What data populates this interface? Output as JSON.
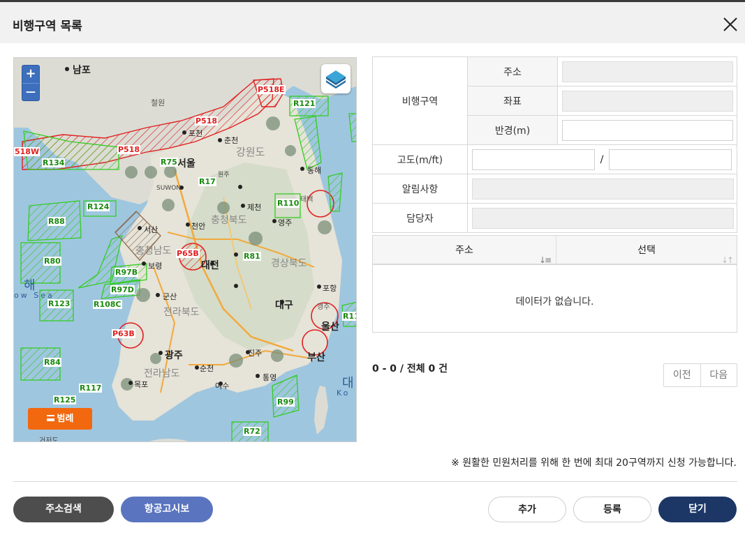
{
  "dialog": {
    "title": "비행구역 목록"
  },
  "map": {
    "zoom_in": "+",
    "zoom_out": "—",
    "legend_button": "범례",
    "labels": {
      "nampo": "남포",
      "cheolwon": "철원",
      "pocheon": "포천",
      "chuncheon": "춘천",
      "gangwondo": "강원도",
      "seoul": "서울",
      "wonju": "원주",
      "donghae": "동해",
      "suwon": "SUWON",
      "jecheon": "제천",
      "taebaek": "태백",
      "cheonan": "천안",
      "chungbuk": "충청북도",
      "yeongju": "영주",
      "seosan": "서산",
      "chungnam": "충청남도",
      "boryeong": "보령",
      "daejeon": "대전",
      "gyeongbuk": "경상북도",
      "pohang": "포항",
      "gunsan": "군산",
      "jeonbuk": "전라북도",
      "daegu": "대구",
      "gyeongju": "경주",
      "ulsan": "울산",
      "gwangju": "광주",
      "jinju": "진주",
      "busan": "부산",
      "jeonnam": "전라남도",
      "suncheon": "순천",
      "yeosu": "여수",
      "mokpo": "목포",
      "tongyeong": "통영",
      "geojedo": "거저도",
      "sea_left": "해",
      "sea_left_en": "ow Sea",
      "sea_right": "대",
      "sea_right_en": "Ko"
    },
    "zones": [
      "P518E",
      "P518",
      "P518",
      "518W",
      "R121",
      "R134",
      "R75",
      "R17",
      "R110",
      "R124",
      "R88",
      "P65B",
      "R81",
      "R80",
      "R97B",
      "R97D",
      "R123",
      "R108C",
      "R11",
      "P63B",
      "R84",
      "R117",
      "R125",
      "R99",
      "R72"
    ]
  },
  "form": {
    "area_label": "비행구역",
    "address_label": "주소",
    "coord_label": "좌표",
    "radius_label": "반경(m)",
    "altitude_label": "고도(m/ft)",
    "altitude_sep": "/",
    "notice_label": "알림사항",
    "manager_label": "담당자"
  },
  "list": {
    "col_address": "주소",
    "col_select": "선택",
    "empty": "데이터가 없습니다."
  },
  "pagination": {
    "summary": "0 - 0 / 전체 0 건",
    "prev": "이전",
    "next": "다음"
  },
  "notice": "※ 원활한 민원처리를 위해 한 번에 최대 20구역까지 신청 가능합니다.",
  "buttons": {
    "address_search": "주소검색",
    "aviation_notice": "항공고시보",
    "add": "추가",
    "register": "등록",
    "close": "닫기"
  },
  "colors": {
    "primary": "#1c3766",
    "secondary": "#5a74bf",
    "dark": "#4d4d4d",
    "orange": "#f2680e",
    "zone_green": "#33cc22",
    "zone_red": "#e02020"
  }
}
